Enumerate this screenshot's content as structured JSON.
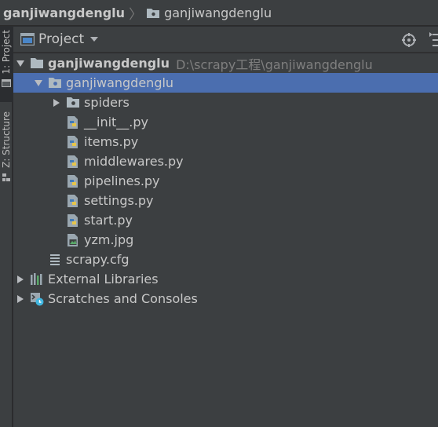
{
  "breadcrumb": {
    "root": "ganjiwangdenglu",
    "separator": "〉",
    "child": "ganjiwangdenglu"
  },
  "side_tabs": {
    "project": "1: Project",
    "structure": "Z: Structure"
  },
  "panel": {
    "title": "Project"
  },
  "tree": {
    "root": {
      "label": "ganjiwangdenglu",
      "path": "D:\\scrapy工程\\ganjiwangdenglu",
      "expanded": true
    },
    "package": {
      "label": "ganjiwangdenglu",
      "expanded": true,
      "selected": true
    },
    "spiders": {
      "label": "spiders",
      "expanded": false
    },
    "files": [
      {
        "label": "__init__.py",
        "icon": "python-file-icon"
      },
      {
        "label": "items.py",
        "icon": "python-file-icon"
      },
      {
        "label": "middlewares.py",
        "icon": "python-file-icon"
      },
      {
        "label": "pipelines.py",
        "icon": "python-file-icon"
      },
      {
        "label": "settings.py",
        "icon": "python-file-icon"
      },
      {
        "label": "start.py",
        "icon": "python-file-icon"
      },
      {
        "label": "yzm.jpg",
        "icon": "image-file-icon"
      }
    ],
    "config": {
      "label": "scrapy.cfg",
      "icon": "config-file-icon"
    },
    "external_libraries": {
      "label": "External Libraries",
      "expanded": false
    },
    "scratches": {
      "label": "Scratches and Consoles",
      "expanded": false
    }
  },
  "colors": {
    "selection": "#4b6eaf",
    "panel_bg": "#3c3f41",
    "text": "#c8c8c8",
    "path_hint": "#7f7f7f"
  }
}
